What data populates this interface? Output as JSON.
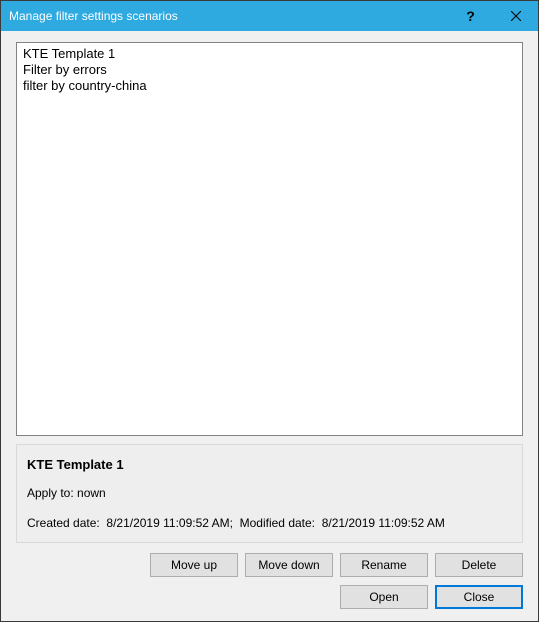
{
  "titlebar": {
    "title": "Manage filter settings scenarios",
    "help": "?",
    "close": "×"
  },
  "list": {
    "items": [
      "KTE Template 1",
      "Filter by errors",
      "filter by country-china"
    ]
  },
  "details": {
    "title": "KTE Template 1",
    "apply_label": "Apply to:",
    "apply_value": "nown",
    "created_label": "Created date:",
    "created_value": "8/21/2019 11:09:52 AM",
    "separator": ";",
    "modified_label": "Modified date:",
    "modified_value": "8/21/2019 11:09:52 AM"
  },
  "buttons": {
    "move_up": "Move up",
    "move_down": "Move down",
    "rename": "Rename",
    "delete": "Delete",
    "open": "Open",
    "close": "Close"
  }
}
